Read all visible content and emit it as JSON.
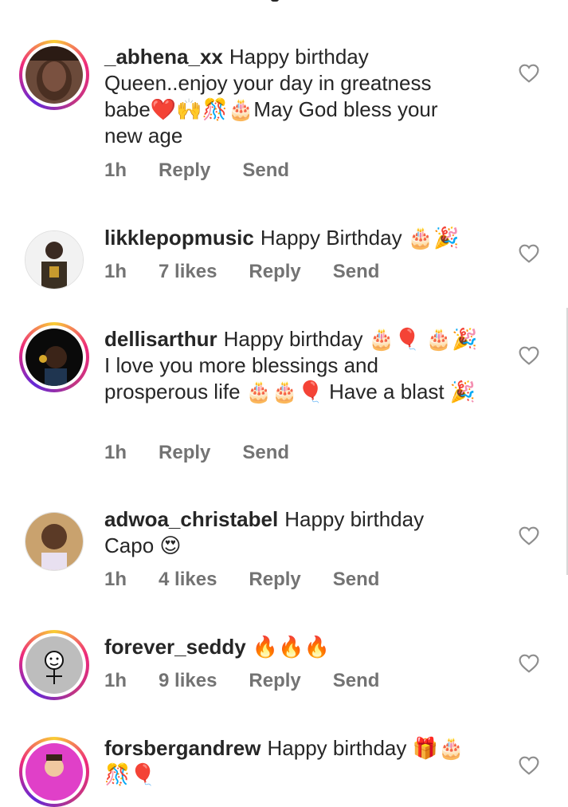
{
  "comments": [
    {
      "username": "_abhena_xx",
      "text": "Happy birthday Queen..enjoy your day in greatness babe❤️🙌🎊🎂May God bless your new age",
      "time": "1h",
      "likes": "",
      "reply": "Reply",
      "send": "Send"
    },
    {
      "username": "likklepopmusic",
      "text": "Happy Birthday 🎂🎉",
      "time": "1h",
      "likes": "7 likes",
      "reply": "Reply",
      "send": "Send"
    },
    {
      "username": "dellisarthur",
      "text": "Happy birthday 🎂🎈 🎂🎉 I love you more blessings and prosperous life 🎂🎂🎈 Have a blast 🎉",
      "time": "1h",
      "likes": "",
      "reply": "Reply",
      "send": "Send"
    },
    {
      "username": "adwoa_christabel",
      "text": "Happy birthday Capo 😍",
      "time": "1h",
      "likes": "4 likes",
      "reply": "Reply",
      "send": "Send"
    },
    {
      "username": "forever_seddy",
      "text": "🔥🔥🔥",
      "time": "1h",
      "likes": "9 likes",
      "reply": "Reply",
      "send": "Send"
    },
    {
      "username": "forsbergandrew",
      "text": "Happy birthday 🎁🎂 🎊🎈",
      "time": "",
      "likes": "",
      "reply": "",
      "send": ""
    }
  ],
  "icons": {
    "like": "heart-outline-icon"
  },
  "colors": {
    "text": "#262626",
    "meta": "#737373",
    "story_ring_start": "#f9ce34",
    "story_ring_mid": "#ee2a7b",
    "story_ring_end": "#6228d7"
  }
}
